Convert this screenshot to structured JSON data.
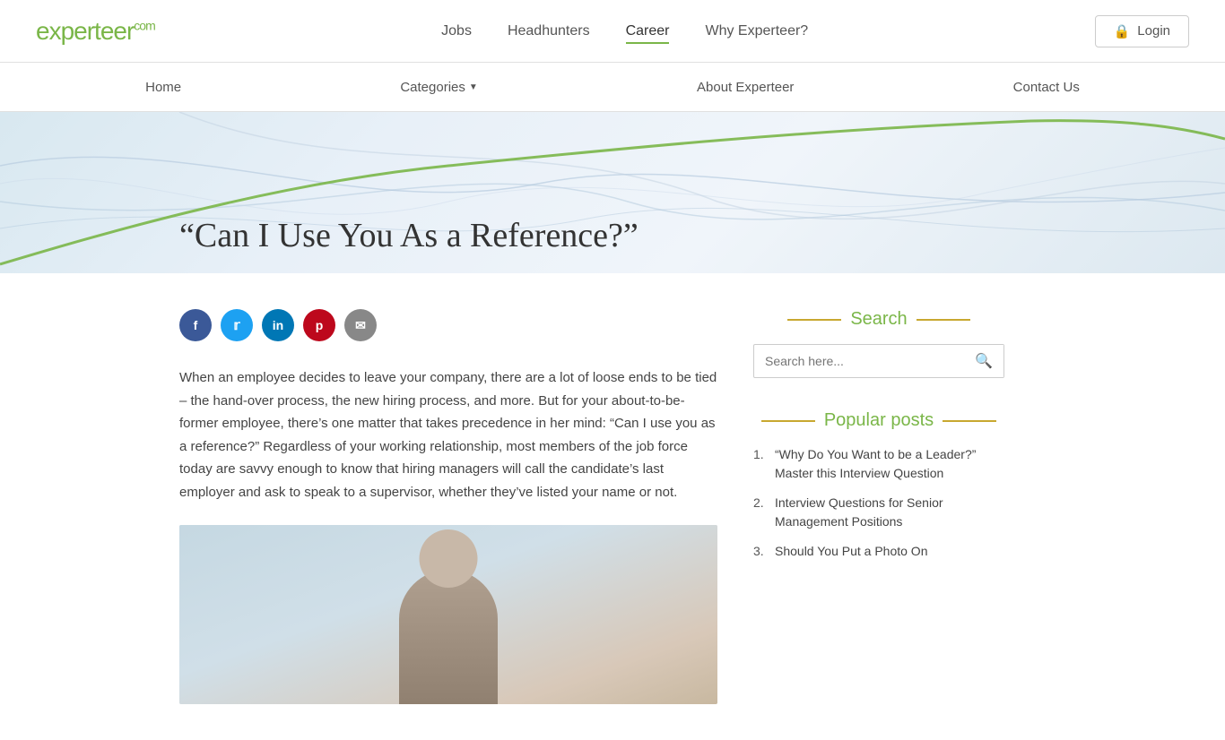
{
  "logo": {
    "text_main": "experteer",
    "text_super": "com"
  },
  "top_nav": {
    "links": [
      {
        "label": "Jobs",
        "active": false
      },
      {
        "label": "Headhunters",
        "active": false
      },
      {
        "label": "Career",
        "active": true
      },
      {
        "label": "Why Experteer?",
        "active": false
      }
    ],
    "login_label": "Login"
  },
  "secondary_nav": {
    "links": [
      {
        "label": "Home"
      },
      {
        "label": "Categories",
        "has_dropdown": true
      },
      {
        "label": "About Experteer"
      },
      {
        "label": "Contact Us"
      }
    ]
  },
  "article": {
    "title": "“Can I Use You As a Reference?”",
    "body": "When an employee decides to leave your company, there are a lot of loose ends to be tied – the hand-over process, the new hiring process, and more. But for your about-to-be-former employee, there’s one matter that takes precedence in her mind: “Can I use you as a reference?” Regardless of your working relationship, most members of the job force today are savvy enough to know that hiring managers will call the candidate’s last employer and ask to speak to a supervisor, whether they’ve listed your name or not."
  },
  "social": {
    "facebook": "f",
    "twitter": "t",
    "linkedin": "in",
    "pinterest": "p",
    "email": "✉"
  },
  "sidebar": {
    "search_title": "Search",
    "search_placeholder": "Search here...",
    "popular_title": "Popular posts",
    "popular_posts": [
      {
        "number": "1.",
        "text": "“Why Do You Want to be a Leader?” Master this Interview Question"
      },
      {
        "number": "2.",
        "text": "Interview Questions for Senior Management Positions"
      },
      {
        "number": "3.",
        "text": "Should You Put a Photo On"
      }
    ]
  }
}
